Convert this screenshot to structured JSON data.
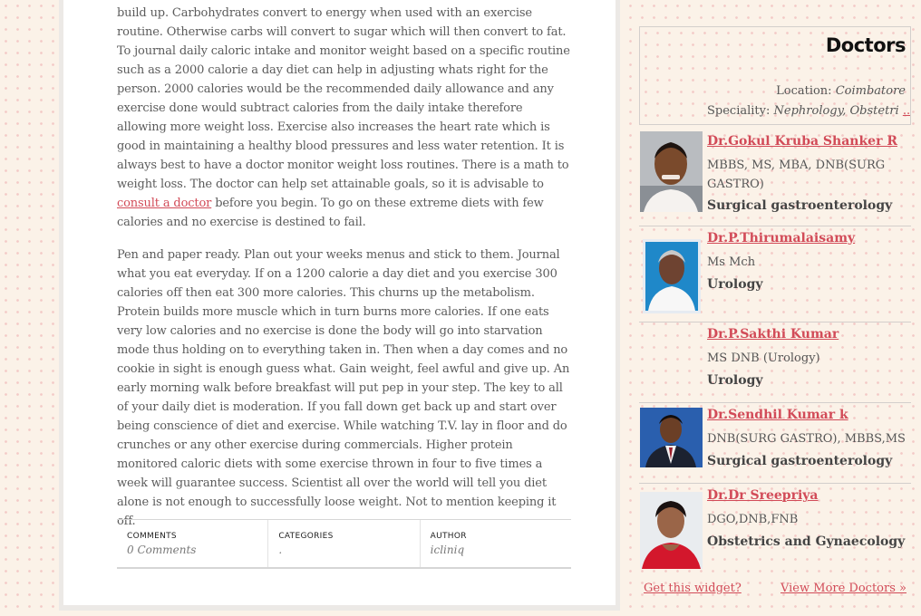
{
  "article": {
    "p1_a": "build up. Carbohydrates convert to energy when used with an exercise routine. Otherwise carbs will convert to sugar which will then convert to fat. To journal daily caloric intake and monitor weight based on a specific routine such as a 2000 calorie a day diet can help in adjusting whats right for the person. 2000 calories would be the recommended daily allowance and any exercise done would subtract calories from the daily intake therefore allowing more weight loss. Exercise also increases the heart rate which is good in maintaining a healthy blood pressures and less water retention. It is always best to have a doctor monitor weight loss routines. There is a math to weight loss. The doctor can help set attainable goals, so it is advisable to ",
    "p1_link": "consult a doctor",
    "p1_b": " before you begin. To go on these extreme diets with few calories and no exercise is destined to fail.",
    "p2": "Pen and paper ready. Plan out your weeks menus and stick to them. Journal what you eat everyday. If on a 1200 calorie a day diet and you exercise 300 calories off then eat 300 more calories. This churns up the metabolism. Protein builds more muscle which in turn burns more calories. If one eats very low calories and no exercise is done the body will go into starvation mode thus holding on to everything taken in. Then when a day comes and no cookie in sight is enough guess what. Gain weight, feel awful and give up. An early morning walk before breakfast will put pep in your step. The key to all of your daily diet is moderation. If you fall down get back up and start over being conscience of diet and exercise. While watching T.V. lay in floor and do crunches or any other exercise during commercials. Higher protein monitored caloric diets with some exercise thrown in four to five times a week will guarantee success. Scientist all over the world will tell you diet alone is not enough to successfully loose weight. Not to mention keeping it off."
  },
  "meta": {
    "comments_label": "COMMENTS",
    "comments_value": "0 Comments",
    "categories_label": "CATEGORIES",
    "categories_value": ".",
    "author_label": "AUTHOR",
    "author_value": "icliniq"
  },
  "widget": {
    "title": "Doctors",
    "location_label": "Location:",
    "location_value": "Coimbatore",
    "speciality_label": "Speciality:",
    "speciality_value": "Nephrology, Obstetri",
    "more": "...",
    "get_widget": "Get this widget?",
    "view_more": "View More Doctors »",
    "doctors": [
      {
        "name": "Dr.Gokul Kruba Shanker R",
        "degree": "MBBS, MS, MBA, DNB(SURG GASTRO)",
        "specialty": "Surgical gastroenterology"
      },
      {
        "name": "Dr.P.Thirumalaisamy",
        "degree": "Ms Mch",
        "specialty": "Urology"
      },
      {
        "name": "Dr.P.Sakthi Kumar",
        "degree": "MS DNB (Urology)",
        "specialty": "Urology"
      },
      {
        "name": "Dr.Sendhil Kumar k",
        "degree": "DNB(SURG GASTRO), MBBS,MS",
        "specialty": "Surgical gastroenterology"
      },
      {
        "name": "Dr.Dr Sreepriya",
        "degree": "DGO,DNB,FNB",
        "specialty": "Obstetrics and Gynaecology"
      }
    ]
  }
}
